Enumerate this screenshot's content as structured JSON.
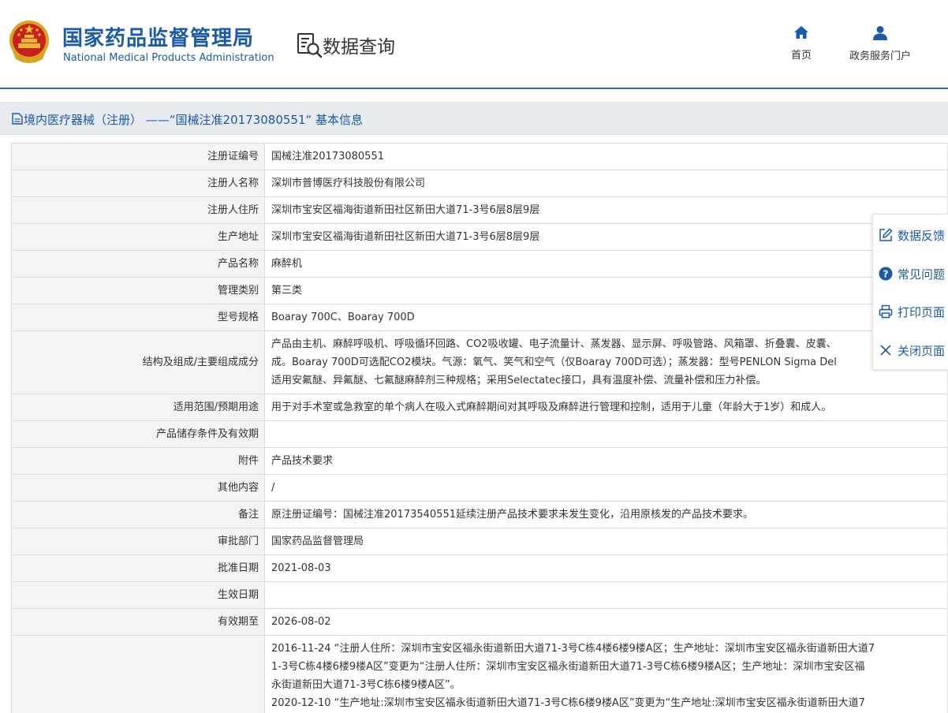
{
  "header": {
    "org_cn": "国家药品监督管理局",
    "org_en": "National Medical Products Administration",
    "query_title": "数据查询",
    "nav": [
      {
        "label": "首页",
        "icon": "home-icon"
      },
      {
        "label": "政务服务门户",
        "icon": "user-icon"
      }
    ]
  },
  "title_bar": {
    "text": "境内医疗器械（注册） ——“国械注准20173080551“ 基本信息",
    "icon": "document-icon"
  },
  "side_panel": [
    {
      "label": "数据反馈",
      "icon": "edit-icon"
    },
    {
      "label": "常见问题",
      "icon": "question-icon"
    },
    {
      "label": "打印页面",
      "icon": "printer-icon"
    },
    {
      "label": "关闭页面",
      "icon": "close-icon"
    }
  ],
  "rows": [
    {
      "label": "注册证编号",
      "value": "国械注准20173080551"
    },
    {
      "label": "注册人名称",
      "value": "深圳市普博医疗科技股份有限公司"
    },
    {
      "label": "注册人住所",
      "value": "深圳市宝安区福海街道新田社区新田大道71-3号6层8层9层"
    },
    {
      "label": "生产地址",
      "value": "深圳市宝安区福海街道新田社区新田大道71-3号6层8层9层"
    },
    {
      "label": "产品名称",
      "value": "麻醉机"
    },
    {
      "label": "管理类别",
      "value": "第三类"
    },
    {
      "label": "型号规格",
      "value": "Boaray 700C、Boaray 700D"
    }
  ],
  "structure": {
    "label": "结构及组成/主要组成成分",
    "lines": [
      "产品由主机、麻醉呼吸机、呼吸循环回路、CO2吸收罐、电子流量计、蒸发器、显示屏、呼吸管路、风箱罩、折叠囊、皮囊、",
      "成。Boaray 700D可选配CO2模块。气源：氧气、笑气和空气（仅Boaray 700D可选）；蒸发器：型号PENLON Sigma Del",
      "适用安氟醚、异氟醚、七氟醚麻醉剂三种规格；采用Selectatec接口，具有温度补偿、流量补偿和压力补偿。"
    ]
  },
  "rows2": [
    {
      "label": "适用范围/预期用途",
      "value": "用于对手术室或急救室的单个病人在吸入式麻醉期间对其呼吸及麻醉进行管理和控制，适用于儿童（年龄大于1岁）和成人。"
    },
    {
      "label": "产品储存条件及有效期",
      "value": ""
    },
    {
      "label": "附件",
      "value": "产品技术要求"
    },
    {
      "label": "其他内容",
      "value": "/"
    },
    {
      "label": "备注",
      "value": "原注册证编号：国械注准20173540551延续注册产品技术要求未发生变化，沿用原核发的产品技术要求。"
    },
    {
      "label": "审批部门",
      "value": "国家药品监督管理局"
    },
    {
      "label": "批准日期",
      "value": "2021-08-03"
    },
    {
      "label": "生效日期",
      "value": ""
    },
    {
      "label": "有效期至",
      "value": "2026-08-02"
    }
  ],
  "changes": {
    "label": "",
    "lines": [
      "2016-11-24 “注册人住所：深圳市宝安区福永街道新田大道71-3号C栋4楼6楼9楼A区；生产地址：深圳市宝安区福永街道新田大道7",
      "1-3号C栋4楼6楼9楼A区”变更为“注册人住所：深圳市宝安区福永街道新田大道71-3号C栋6楼9楼A区；生产地址：深圳市宝安区福",
      "永街道新田大道71-3号C栋6楼9楼A区”。",
      "2020-12-10 “生产地址:深圳市宝安区福永街道新田大道71-3号C栋6楼9楼A区”变更为“生产地址:深圳市宝安区福永街道新田大道7"
    ]
  }
}
